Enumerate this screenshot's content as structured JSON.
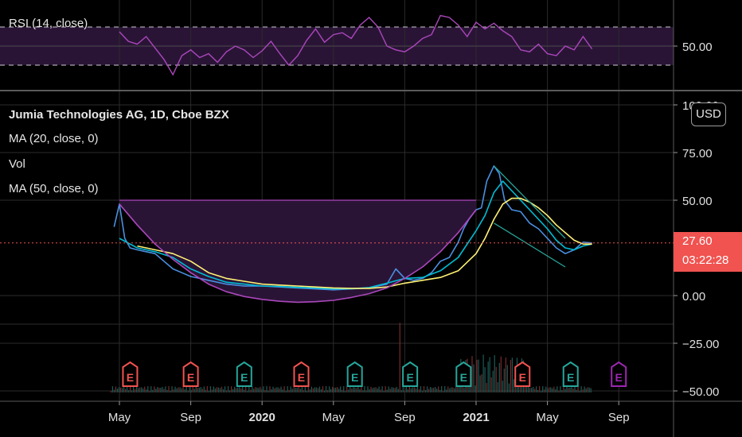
{
  "rsi_pane": {
    "label": "RSI (14, close)",
    "ticks": [
      {
        "v": 50,
        "label": "50.00"
      }
    ],
    "bands": [
      70,
      30
    ]
  },
  "main_pane": {
    "title": "Jumia Technologies AG, 1D, Cboe BZX",
    "indicators": [
      "MA (20, close, 0)",
      "Vol",
      "MA (50, close, 0)"
    ],
    "currency": "USD",
    "price_label": "27.60",
    "countdown": "03:22:28",
    "y_ticks": [
      {
        "v": 100,
        "label": "100.00"
      },
      {
        "v": 75,
        "label": "75.00"
      },
      {
        "v": 50,
        "label": "50.00"
      },
      {
        "v": 0,
        "label": "0.00"
      },
      {
        "v": -25,
        "label": "−25.00"
      },
      {
        "v": -50,
        "label": "−50.00"
      }
    ]
  },
  "x_axis": [
    {
      "label": "May",
      "t": 0,
      "bold": false
    },
    {
      "label": "Sep",
      "t": 4,
      "bold": false
    },
    {
      "label": "2020",
      "t": 8,
      "bold": true
    },
    {
      "label": "May",
      "t": 12,
      "bold": false
    },
    {
      "label": "Sep",
      "t": 16,
      "bold": false
    },
    {
      "label": "2021",
      "t": 20,
      "bold": true
    },
    {
      "label": "May",
      "t": 24,
      "bold": false
    },
    {
      "label": "Sep",
      "t": 28,
      "bold": false
    }
  ],
  "earnings_markers": [
    {
      "t": 0.6,
      "color": "#f05350",
      "label": "E"
    },
    {
      "t": 4.0,
      "color": "#f05350",
      "label": "E"
    },
    {
      "t": 7.0,
      "color": "#26a69a",
      "label": "E"
    },
    {
      "t": 10.2,
      "color": "#f05350",
      "label": "E"
    },
    {
      "t": 13.2,
      "color": "#26a69a",
      "label": "E"
    },
    {
      "t": 16.3,
      "color": "#26a69a",
      "label": "E"
    },
    {
      "t": 19.3,
      "color": "#26a69a",
      "label": "E"
    },
    {
      "t": 22.6,
      "color": "#f05350",
      "label": "E"
    },
    {
      "t": 25.3,
      "color": "#26a69a",
      "label": "E"
    },
    {
      "t": 28.0,
      "color": "#9c27b0",
      "label": "E"
    }
  ],
  "chart_data": {
    "type": "line",
    "title": "Jumia Technologies AG, 1D, Cboe BZX",
    "x_unit": "months since May 2019",
    "ylim": [
      -50,
      100
    ],
    "series": [
      {
        "name": "price",
        "color": "#4a90e2",
        "x": [
          -0.3,
          0,
          0.3,
          0.6,
          1,
          1.5,
          2,
          2.5,
          3,
          3.5,
          4,
          4.5,
          5,
          6,
          7,
          8,
          9,
          10,
          11,
          12,
          13,
          14,
          15,
          15.5,
          16,
          16.5,
          17,
          17.5,
          18,
          18.5,
          19,
          19.3,
          19.6,
          20,
          20.3,
          20.6,
          21,
          21.3,
          21.6,
          22,
          22.5,
          23,
          23.5,
          24,
          24.5,
          25,
          25.5,
          26,
          26.5
        ],
        "y": [
          36,
          48,
          30,
          25,
          24,
          23,
          22,
          18,
          14,
          12,
          10,
          9,
          8,
          6,
          5,
          5,
          4.5,
          4,
          3.5,
          3,
          3.5,
          4,
          6,
          14,
          9,
          8,
          9,
          12,
          18,
          20,
          28,
          35,
          40,
          45,
          46,
          60,
          68,
          64,
          50,
          45,
          44,
          38,
          35,
          30,
          25,
          22,
          24,
          28,
          27.6
        ]
      },
      {
        "name": "MA (20, close, 0)",
        "color": "#00bcd4",
        "x": [
          0,
          1,
          2,
          3,
          4,
          5,
          6,
          7,
          8,
          9,
          10,
          11,
          12,
          13,
          14,
          15,
          16,
          17,
          18,
          19,
          20,
          20.5,
          21,
          21.5,
          22,
          22.5,
          23,
          23.5,
          24,
          24.5,
          25,
          25.5,
          26,
          26.5
        ],
        "y": [
          30,
          25,
          23,
          20,
          14,
          10,
          7,
          6,
          5,
          4.8,
          4.3,
          4,
          3.5,
          3.6,
          4.2,
          6.5,
          9,
          9.5,
          13,
          20,
          34,
          42,
          54,
          60,
          55,
          50,
          45,
          40,
          35,
          29,
          25,
          24,
          26,
          27
        ]
      },
      {
        "name": "MA (50, close, 0)",
        "color": "#fff176",
        "x": [
          1,
          2,
          3,
          4,
          5,
          6,
          7,
          8,
          9,
          10,
          11,
          12,
          13,
          14,
          15,
          16,
          17,
          18,
          19,
          20,
          20.5,
          21,
          21.5,
          22,
          22.5,
          23,
          23.5,
          24,
          24.5,
          25,
          25.5,
          26,
          26.5
        ],
        "y": [
          26,
          24,
          22,
          18,
          12,
          9,
          7.5,
          6,
          5.5,
          5,
          4.5,
          4,
          3.8,
          3.8,
          4.5,
          6.5,
          8,
          9.5,
          13,
          22,
          30,
          40,
          48,
          51,
          51,
          49,
          46,
          42,
          37,
          33,
          29,
          27,
          27
        ]
      },
      {
        "name": "cup",
        "color": "#ab47bc",
        "x": [
          0,
          1,
          2,
          3,
          4,
          5,
          6,
          7,
          8,
          9,
          10,
          11,
          12,
          13,
          14,
          15,
          16,
          17,
          18,
          19,
          20
        ],
        "y": [
          48,
          37,
          27,
          19,
          12,
          6,
          2,
          -0.5,
          -2,
          -3,
          -3.5,
          -3.2,
          -2.5,
          -1,
          1,
          4,
          9,
          15,
          23,
          33,
          45
        ]
      }
    ],
    "annotations": [
      {
        "type": "pennant",
        "upper": [
          [
            21,
            68
          ],
          [
            25,
            30
          ]
        ],
        "lower": [
          [
            21,
            38
          ],
          [
            25,
            15
          ]
        ],
        "color": "#26a69a"
      }
    ],
    "rsi": {
      "name": "RSI (14, close)",
      "color": "#ab47bc",
      "bands": [
        70,
        30
      ],
      "x": [
        0,
        0.5,
        1,
        1.5,
        2,
        2.5,
        3,
        3.5,
        4,
        4.5,
        5,
        5.5,
        6,
        6.5,
        7,
        7.5,
        8,
        8.5,
        9,
        9.5,
        10,
        10.5,
        11,
        11.5,
        12,
        12.5,
        13,
        13.5,
        14,
        14.5,
        15,
        15.5,
        16,
        16.5,
        17,
        17.5,
        18,
        18.5,
        19,
        19.5,
        20,
        20.5,
        21,
        21.5,
        22,
        22.5,
        23,
        23.5,
        24,
        24.5,
        25,
        25.5,
        26,
        26.5
      ],
      "y": [
        65,
        55,
        52,
        60,
        48,
        36,
        20,
        40,
        46,
        38,
        42,
        33,
        44,
        50,
        46,
        38,
        45,
        55,
        42,
        30,
        40,
        56,
        68,
        54,
        62,
        64,
        58,
        72,
        80,
        70,
        50,
        46,
        44,
        50,
        58,
        62,
        82,
        80,
        72,
        60,
        75,
        68,
        74,
        66,
        60,
        46,
        44,
        52,
        42,
        40,
        50,
        46,
        60,
        47
      ]
    }
  }
}
